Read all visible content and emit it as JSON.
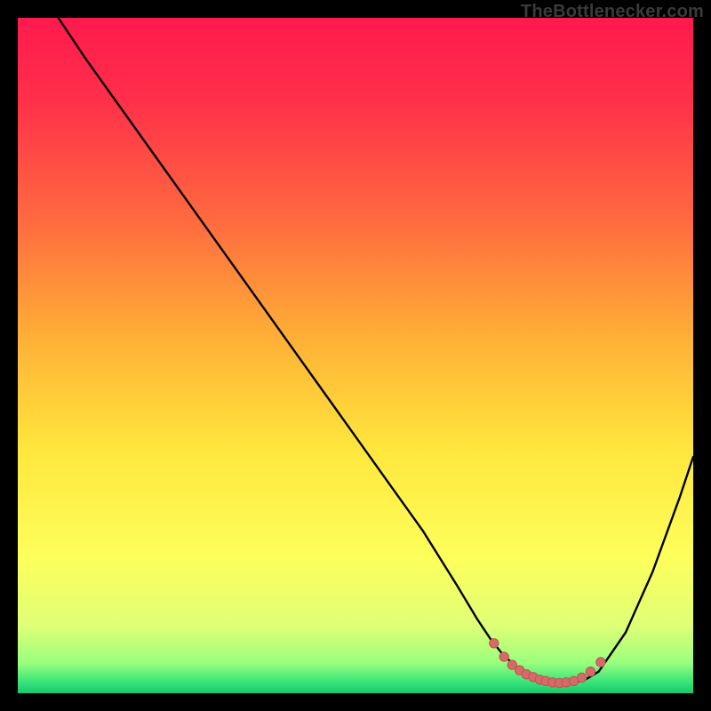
{
  "attribution": "TheBottlenecker.com",
  "colors": {
    "gradient_stops": [
      {
        "offset": 0.0,
        "color": "#ff1a4d"
      },
      {
        "offset": 0.12,
        "color": "#ff2f4a"
      },
      {
        "offset": 0.3,
        "color": "#ff6a3f"
      },
      {
        "offset": 0.48,
        "color": "#ffb236"
      },
      {
        "offset": 0.64,
        "color": "#ffe73d"
      },
      {
        "offset": 0.8,
        "color": "#fdff5b"
      },
      {
        "offset": 0.9,
        "color": "#dfff77"
      },
      {
        "offset": 0.955,
        "color": "#9aff7d"
      },
      {
        "offset": 0.985,
        "color": "#34e27a"
      },
      {
        "offset": 1.0,
        "color": "#18c96c"
      }
    ],
    "curve": "#000000",
    "marker_fill": "#d76a68",
    "marker_stroke": "#bf5452"
  },
  "chart_data": {
    "type": "line",
    "title": "",
    "xlabel": "",
    "ylabel": "",
    "xlim": [
      0,
      100
    ],
    "ylim": [
      0,
      100
    ],
    "series": [
      {
        "name": "bottleneck-curve",
        "x": [
          6,
          10,
          15,
          20,
          25,
          30,
          35,
          40,
          45,
          50,
          55,
          60,
          65,
          68,
          70,
          72,
          74,
          76,
          78,
          80,
          82,
          84,
          86,
          90,
          94,
          98,
          100
        ],
        "y": [
          100,
          94,
          87,
          80,
          73,
          66,
          59,
          52,
          45,
          38,
          31,
          24,
          16,
          11,
          8,
          5.5,
          3.8,
          2.6,
          1.9,
          1.5,
          1.5,
          2.0,
          3.2,
          9,
          18,
          29,
          35
        ]
      }
    ],
    "markers": {
      "name": "optimal-range",
      "x": [
        70.5,
        72.0,
        73.2,
        74.3,
        75.3,
        76.3,
        77.3,
        78.2,
        79.2,
        80.2,
        81.2,
        82.3,
        83.5,
        84.8,
        86.3
      ],
      "y": [
        7.4,
        5.4,
        4.2,
        3.4,
        2.8,
        2.4,
        2.0,
        1.8,
        1.6,
        1.5,
        1.6,
        1.8,
        2.3,
        3.2,
        4.6
      ]
    }
  }
}
